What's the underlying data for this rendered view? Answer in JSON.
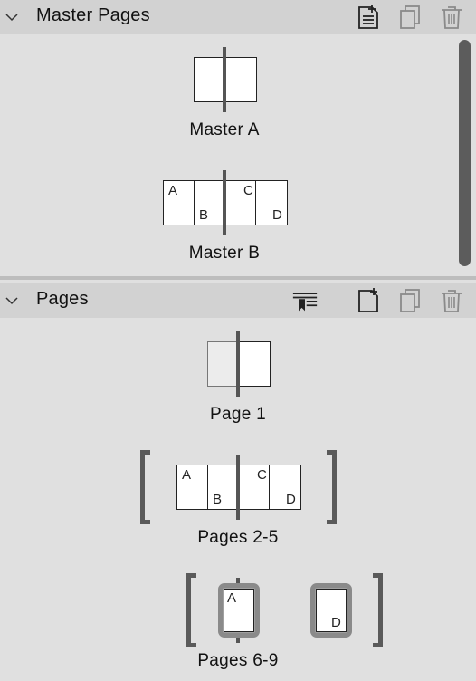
{
  "master_section": {
    "title": "Master Pages",
    "buttons": [
      "new-master-icon",
      "duplicate-icon",
      "trash-icon"
    ],
    "masters": [
      {
        "label": "Master A"
      },
      {
        "label": "Master B",
        "page_letters": [
          "A",
          "B",
          "C",
          "D"
        ]
      }
    ]
  },
  "pages_section": {
    "title": "Pages",
    "buttons": [
      "apply-master-icon",
      "new-page-icon",
      "duplicate-icon",
      "trash-icon"
    ],
    "groups": [
      {
        "label": "Page 1"
      },
      {
        "label": "Pages 2-5",
        "page_letters": [
          "A",
          "B",
          "C",
          "D"
        ]
      },
      {
        "label": "Pages 6-9",
        "page_letters": [
          "A",
          "D"
        ]
      }
    ]
  }
}
